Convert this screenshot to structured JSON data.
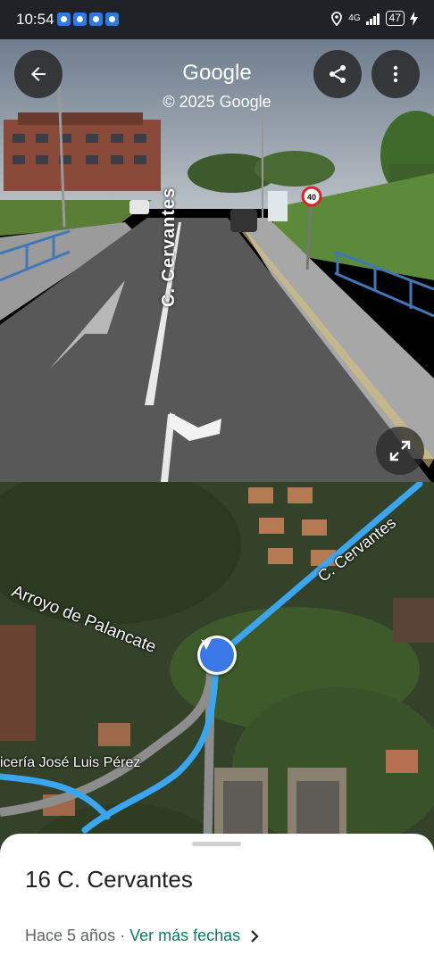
{
  "status_bar": {
    "time": "10:54",
    "network": "4G",
    "battery": "47",
    "app_icons": [
      "settings-app-icon",
      "messenger-app-icon",
      "mail-app-icon",
      "video-app-icon"
    ]
  },
  "streetview": {
    "title": "Google",
    "copyright": "© 2025 Google",
    "street_label": "C. Cervantes",
    "speed_sign": "40"
  },
  "map": {
    "labels": {
      "road_1": "C. Cervantes",
      "stream": "Arroyo de Palancate",
      "business": "icería José Luis Pérez"
    }
  },
  "sheet": {
    "address": "16 C. Cervantes",
    "age": "Hace 5 años",
    "separator": " · ",
    "more_dates": "Ver más fechas"
  },
  "colors": {
    "road_highlight": "#3aa6f0",
    "link": "#0b7a66",
    "pegman": "#3a78e8"
  }
}
